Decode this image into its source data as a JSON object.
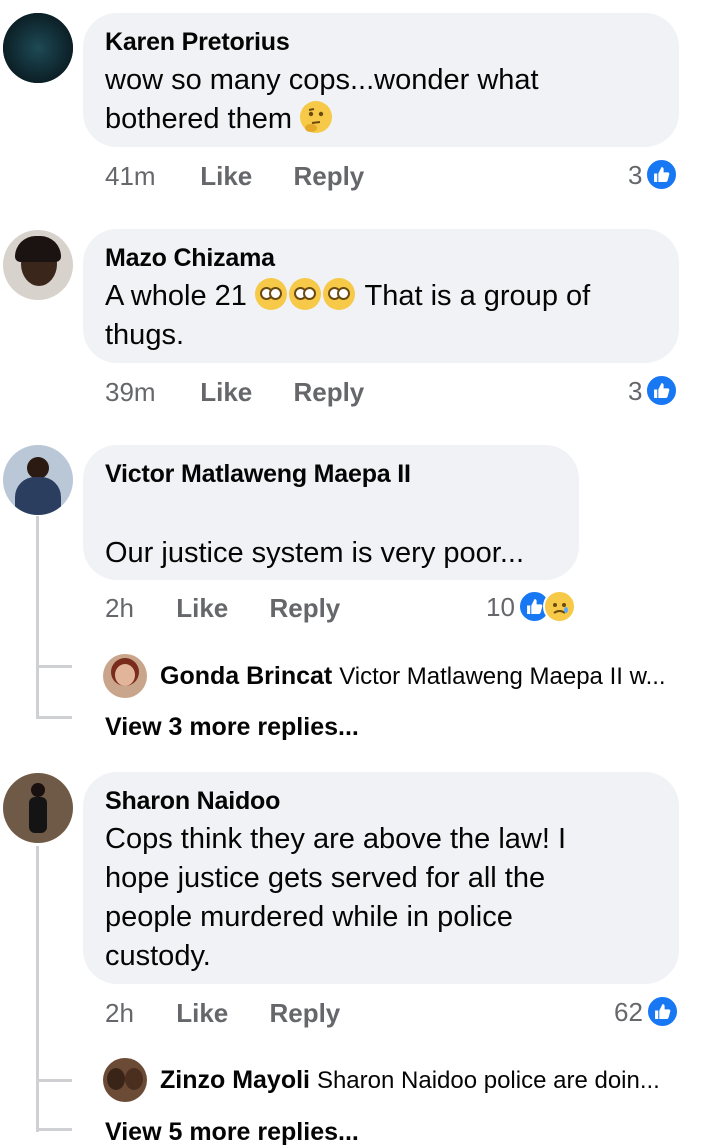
{
  "comments": [
    {
      "author": "Karen Pretorius",
      "text": "wow so many cops...wonder what bothered them",
      "emoji": "thinking-face",
      "time": "41m",
      "like_label": "Like",
      "reply_label": "Reply",
      "reaction_count": "3"
    },
    {
      "author": "Mazo Chizama",
      "text_prefix": "A whole 21",
      "emoji": "flushed-face x3",
      "text_suffix": "That is a group of thugs.",
      "text_line1_suffix": "That is a group of",
      "text_line2": "thugs.",
      "time": "39m",
      "like_label": "Like",
      "reply_label": "Reply",
      "reaction_count": "3"
    },
    {
      "author": "Victor Matlaweng Maepa II",
      "text": "Our justice system is very poor...",
      "time": "2h",
      "like_label": "Like",
      "reply_label": "Reply",
      "reaction_count": "10",
      "reply_preview": {
        "author": "Gonda Brincat",
        "text": "Victor Matlaweng Maepa II w..."
      },
      "more_replies": "View 3 more replies..."
    },
    {
      "author": "Sharon Naidoo",
      "text_lines": [
        "Cops think they are above the law! I",
        "hope justice gets served for all the",
        "people murdered while in police",
        "custody."
      ],
      "time": "2h",
      "like_label": "Like",
      "reply_label": "Reply",
      "reaction_count": "62",
      "reply_preview": {
        "author": "Zinzo Mayoli",
        "text": "Sharon Naidoo police are doin..."
      },
      "more_replies": "View 5 more replies..."
    }
  ],
  "colors": {
    "bubble": "#f0f2f5",
    "meta": "#65676b",
    "like_blue": "#1877f2",
    "thread_line": "#ced0d4"
  }
}
